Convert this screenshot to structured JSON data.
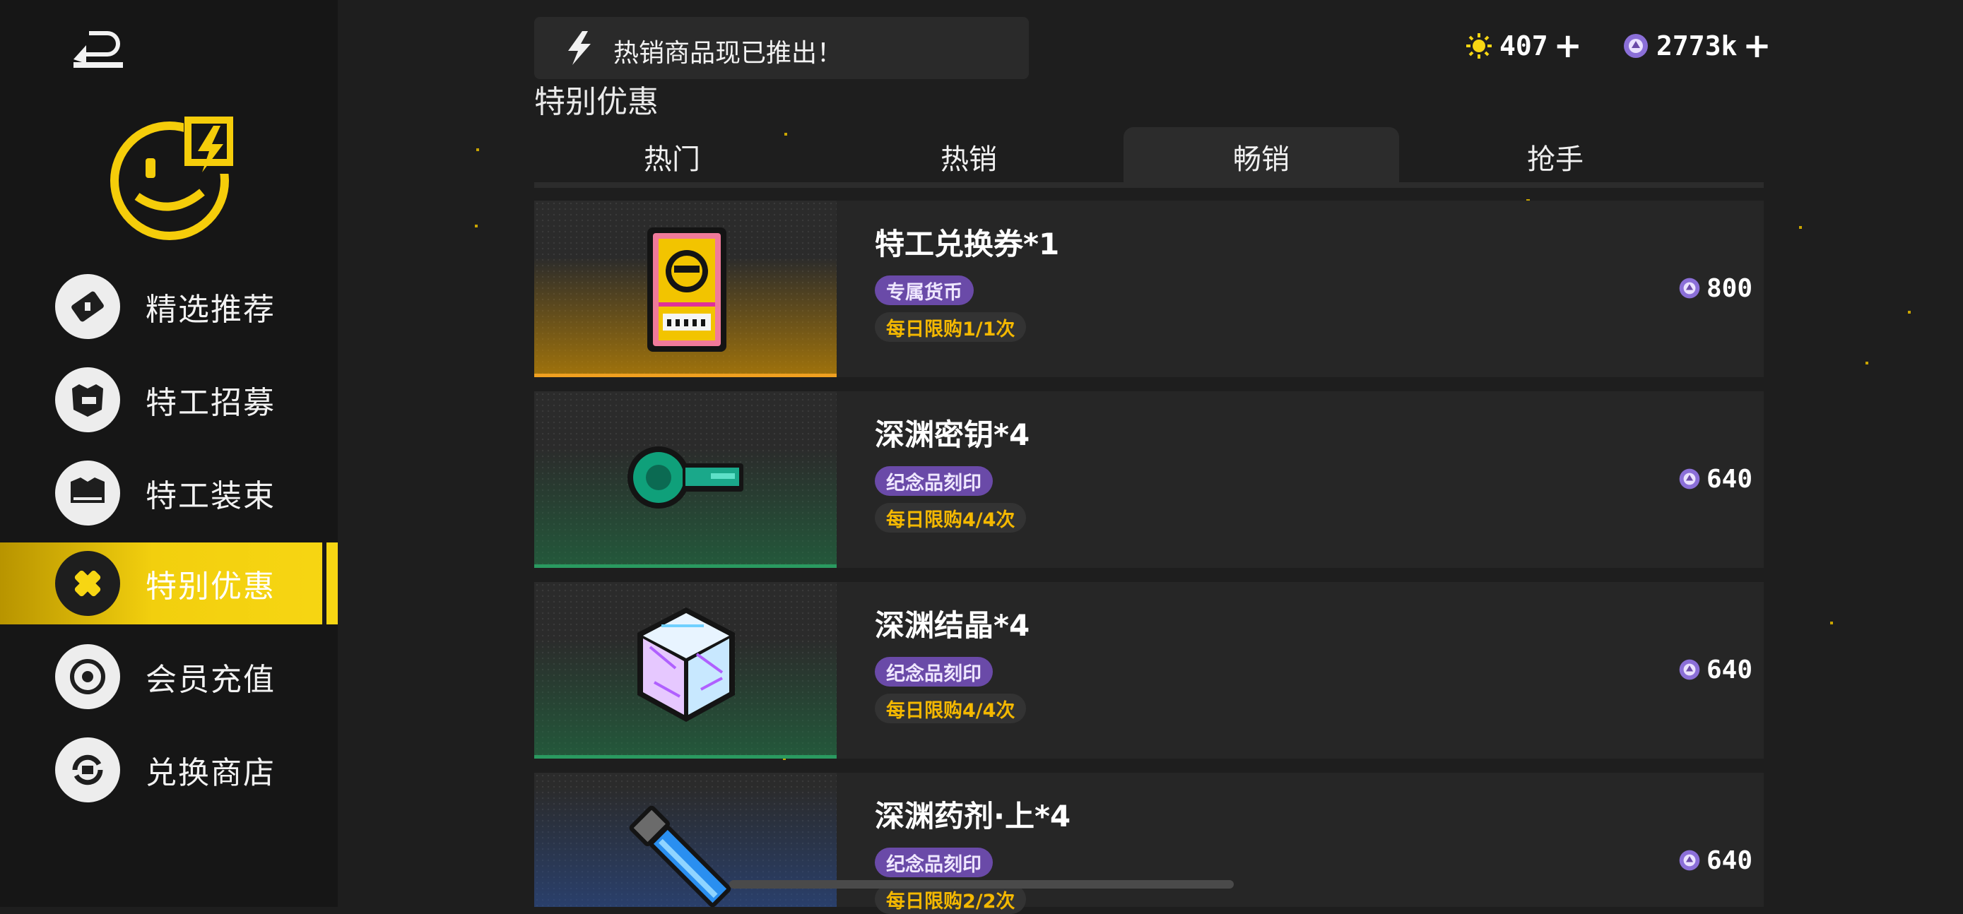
{
  "colors": {
    "accent_yellow": "#f7d613",
    "tag_purple": "#6a4aa8",
    "limit_text": "#f4b800",
    "bg": "#1e1e1e"
  },
  "sidebar": {
    "back_icon": "back-arrow-icon",
    "logo_icon": "smiley-bolt-logo",
    "items": [
      {
        "label": "精选推荐",
        "icon": "ticket-icon",
        "active": false
      },
      {
        "label": "特工招募",
        "icon": "agent-head-icon",
        "active": false
      },
      {
        "label": "特工装束",
        "icon": "outfit-icon",
        "active": false
      },
      {
        "label": "特别优惠",
        "icon": "bandage-icon",
        "active": true
      },
      {
        "label": "会员充值",
        "icon": "target-icon",
        "active": false
      },
      {
        "label": "兑换商店",
        "icon": "exchange-icon",
        "active": false
      }
    ]
  },
  "header": {
    "banner_text": "热销商品现已推出！",
    "currency1": {
      "icon": "sun-coin-icon",
      "value": "407"
    },
    "currency2": {
      "icon": "purple-gem-icon",
      "value": "2773k"
    }
  },
  "section": {
    "title": "特别优惠"
  },
  "tabs": [
    {
      "label": "热门",
      "active": false
    },
    {
      "label": "热销",
      "active": false
    },
    {
      "label": "畅销",
      "active": true
    },
    {
      "label": "抢手",
      "active": false
    }
  ],
  "products": [
    {
      "name": "特工兑换券*1",
      "tag": "专属货币",
      "limit": "每日限购1/1次",
      "price": "800",
      "icon": "agent-ticket-icon",
      "theme": "orange"
    },
    {
      "name": "深渊密钥*4",
      "tag": "纪念品刻印",
      "limit": "每日限购4/4次",
      "price": "640",
      "icon": "abyss-key-icon",
      "theme": "green"
    },
    {
      "name": "深渊结晶*4",
      "tag": "纪念品刻印",
      "limit": "每日限购4/4次",
      "price": "640",
      "icon": "abyss-crystal-icon",
      "theme": "green"
    },
    {
      "name": "深渊药剂·上*4",
      "tag": "纪念品刻印",
      "limit": "每日限购2/2次",
      "price": "640",
      "icon": "abyss-potion-icon",
      "theme": "blue"
    }
  ]
}
